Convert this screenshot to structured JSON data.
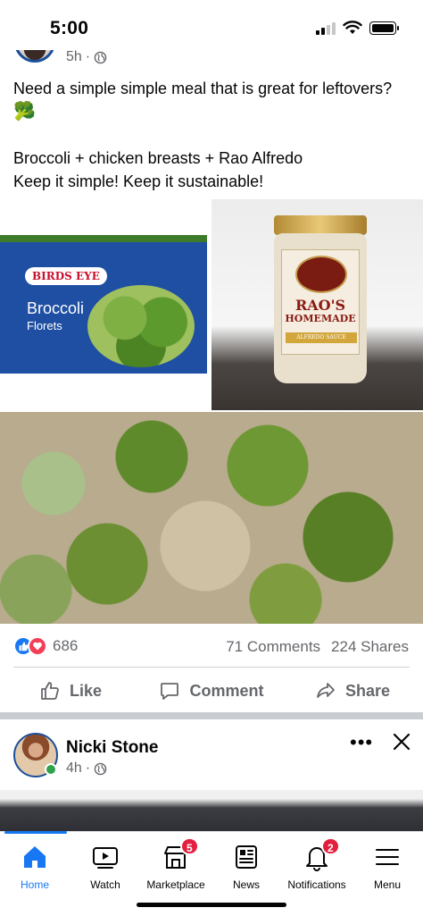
{
  "status_bar": {
    "time": "5:00"
  },
  "post1": {
    "time_ago": "5h",
    "privacy_sep": "·",
    "text_lines": [
      "Need a simple simple meal that is great for leftovers?",
      "🥦",
      "",
      "Broccoli + chicken breasts + Rao Alfredo",
      "Keep it simple! Keep it sustainable!"
    ],
    "photos": {
      "bag_brand": "BIRDS EYE",
      "bag_name": "Broccoli",
      "bag_subname": "Florets",
      "jar_brand_line1": "RAO'S",
      "jar_brand_line2": "HOMEMADE",
      "jar_sauce": "ALFREDO SAUCE"
    },
    "reaction_count": "686",
    "comments": "71 Comments",
    "shares": "224 Shares",
    "actions": {
      "like": "Like",
      "comment": "Comment",
      "share": "Share"
    }
  },
  "post2": {
    "author": "Nicki Stone",
    "time_ago": "4h",
    "privacy_sep": "·",
    "more_label": "•••"
  },
  "nav": {
    "items": [
      {
        "label": "Home",
        "icon": "home-icon",
        "active": true
      },
      {
        "label": "Watch",
        "icon": "watch-icon"
      },
      {
        "label": "Marketplace",
        "icon": "marketplace-icon",
        "badge": "5"
      },
      {
        "label": "News",
        "icon": "news-icon"
      },
      {
        "label": "Notifications",
        "icon": "bell-icon",
        "badge": "2"
      },
      {
        "label": "Menu",
        "icon": "menu-icon"
      }
    ]
  },
  "colors": {
    "accent": "#1877f2",
    "badge": "#e41e3f",
    "secondary_text": "#65676b",
    "online": "#31a24c"
  }
}
